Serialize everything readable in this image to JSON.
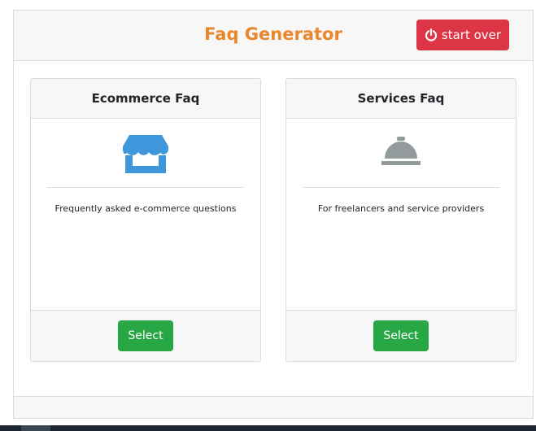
{
  "app": {
    "title": "Faq Generator",
    "start_over_label": "start over"
  },
  "cards": [
    {
      "title": "Ecommerce Faq",
      "icon": "store-icon",
      "description": "Frequently asked e-commerce questions",
      "button_label": "Select"
    },
    {
      "title": "Services Faq",
      "icon": "service-bell-icon",
      "description": "For freelancers and service providers",
      "button_label": "Select"
    }
  ],
  "colors": {
    "title": "#e8872b",
    "danger": "#dc3545",
    "success": "#28a745",
    "store_icon": "#3f97db",
    "bell_icon": "#939a9b"
  }
}
